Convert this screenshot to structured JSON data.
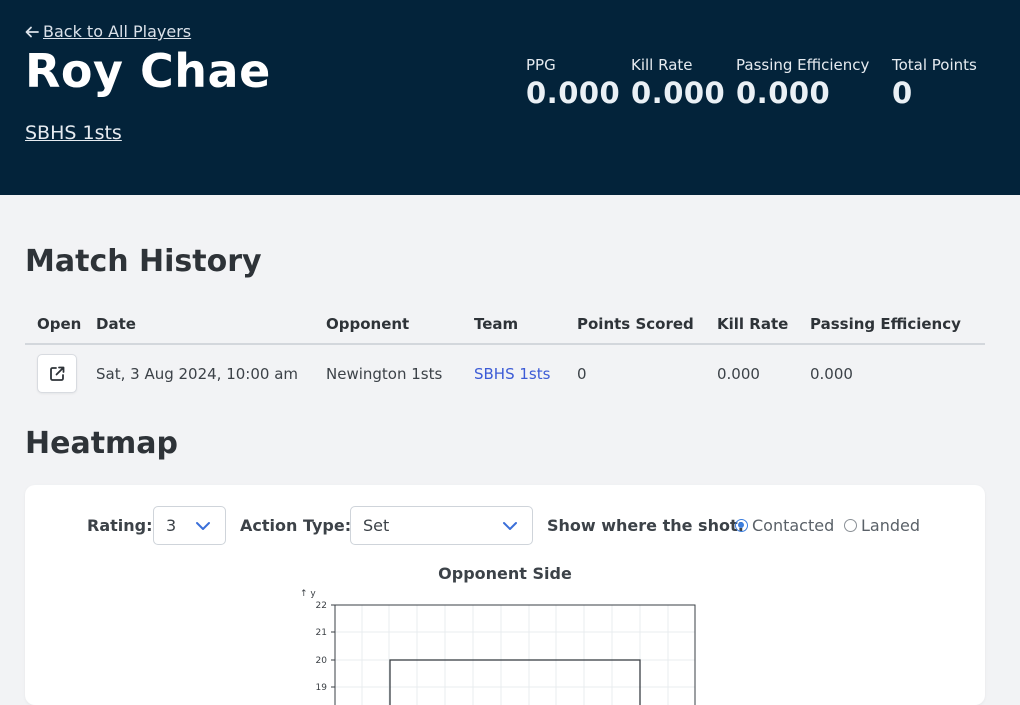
{
  "header": {
    "back_label": "Back to All Players",
    "player_name": "Roy Chae",
    "team_name": "SBHS 1sts",
    "stats": [
      {
        "label": "PPG",
        "value": "0.000"
      },
      {
        "label": "Kill Rate",
        "value": "0.000"
      },
      {
        "label": "Passing Efficiency",
        "value": "0.000"
      },
      {
        "label": "Total Points",
        "value": "0"
      }
    ]
  },
  "match_history": {
    "title": "Match History",
    "columns": [
      "Open",
      "Date",
      "Opponent",
      "Team",
      "Points Scored",
      "Kill Rate",
      "Passing Efficiency"
    ],
    "rows": [
      {
        "open_icon": "external-link-icon",
        "date": "Sat, 3 Aug 2024, 10:00 am",
        "opponent": "Newington 1sts",
        "team": "SBHS 1sts",
        "points_scored": "0",
        "kill_rate": "0.000",
        "passing_efficiency": "0.000"
      }
    ]
  },
  "heatmap": {
    "title": "Heatmap",
    "rating_label": "Rating:",
    "rating_value": "3",
    "action_type_label": "Action Type:",
    "action_type_value": "Set",
    "show_label": "Show where the shot:",
    "options": [
      {
        "label": "Contacted",
        "selected": true
      },
      {
        "label": "Landed",
        "selected": false
      }
    ],
    "chart_title": "Opponent Side",
    "y_axis_label": "↑ y",
    "y_ticks": [
      "22",
      "21",
      "20",
      "19"
    ]
  },
  "colors": {
    "hero_bg": "#03233a",
    "accent": "#3b7ddd",
    "link": "#3c5bd6"
  }
}
